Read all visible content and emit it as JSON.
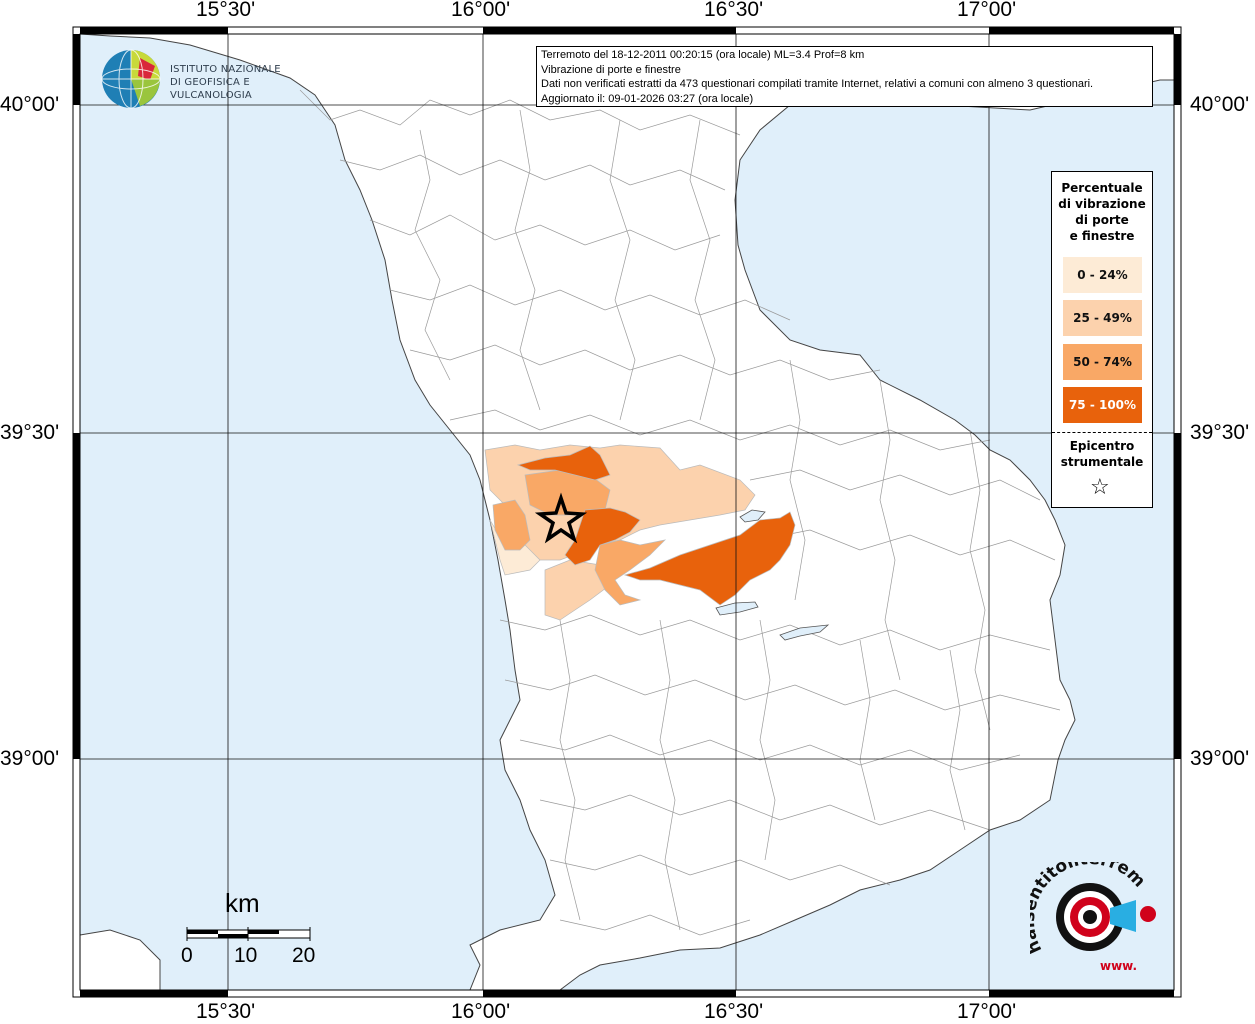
{
  "header": {
    "line1": "Terremoto del 18-12-2011 00:20:15 (ora locale) ML=3.4 Prof=8 km",
    "line2": "Vibrazione di porte e finestre",
    "line3": "Dati non verificati estratti da 473 questionari compilati tramite Internet, relativi a comuni con almeno 3 questionari.",
    "line4": "Aggiornato il: 09-01-2026 03:27 (ora locale)"
  },
  "logo_ingv": {
    "line1": "ISTITUTO NAZIONALE",
    "line2": "DI GEOFISICA E VULCANOLOGIA"
  },
  "axes": {
    "longitude_labels": [
      "15°30'",
      "16°00'",
      "16°30'",
      "17°00'"
    ],
    "latitude_labels": [
      "40°00'",
      "39°30'",
      "39°00'"
    ]
  },
  "legend": {
    "title_lines": [
      "Percentuale",
      "di vibrazione",
      "di porte",
      "e finestre"
    ],
    "classes": [
      {
        "label": "0 - 24%",
        "color": "#fdebd6"
      },
      {
        "label": "25 - 49%",
        "color": "#fcd2ad"
      },
      {
        "label": "50 - 74%",
        "color": "#f9a866"
      },
      {
        "label": "75 - 100%",
        "color": "#e8620c"
      }
    ],
    "epicenter_lines": [
      "Epicentro",
      "strumentale"
    ],
    "epicenter_symbol": "star-icon"
  },
  "scale_bar": {
    "unit": "km",
    "ticks": [
      "0",
      "10",
      "20"
    ]
  },
  "watermark": {
    "text": "haisentitoilterremoto.it",
    "prefix": "www."
  },
  "colors": {
    "sea": "#e0effa",
    "land": "#ffffff",
    "frame": "#000000",
    "grid": "#000000"
  }
}
